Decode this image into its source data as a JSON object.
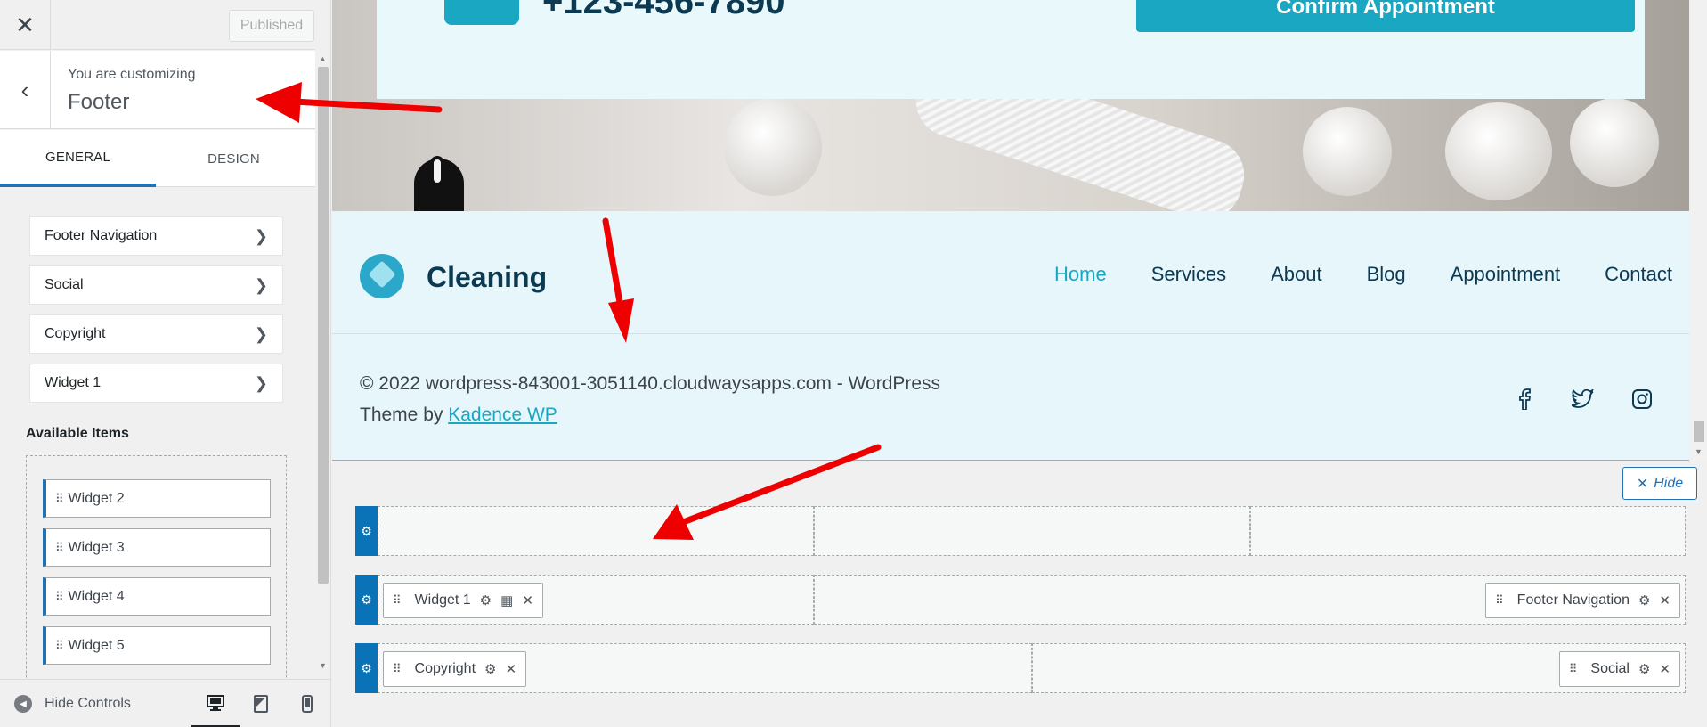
{
  "colors": {
    "accent": "#2271b1",
    "brand": "#19a7c2",
    "brand_dark": "#0c3a52",
    "arrow": "#ee0000"
  },
  "topbar": {
    "close_icon": "close-icon",
    "published_label": "Published"
  },
  "customizing": {
    "label": "You are customizing",
    "title": "Footer"
  },
  "tabs": [
    {
      "label": "GENERAL",
      "active": true
    },
    {
      "label": "DESIGN",
      "active": false
    }
  ],
  "sections": [
    {
      "label": "Footer Navigation"
    },
    {
      "label": "Social"
    },
    {
      "label": "Copyright"
    },
    {
      "label": "Widget 1"
    }
  ],
  "available": {
    "title": "Available Items",
    "items": [
      {
        "label": "Widget 2"
      },
      {
        "label": "Widget 3"
      },
      {
        "label": "Widget 4"
      },
      {
        "label": "Widget 5"
      }
    ]
  },
  "controls": {
    "hide_label": "Hide Controls",
    "devices": [
      "desktop-icon",
      "tablet-icon",
      "mobile-icon"
    ]
  },
  "site": {
    "phone": "+123-456-7890",
    "confirm_label": "Confirm Appointment",
    "logo_text": "Cleaning",
    "nav": [
      {
        "label": "Home",
        "current": true
      },
      {
        "label": "Services",
        "current": false
      },
      {
        "label": "About",
        "current": false
      },
      {
        "label": "Blog",
        "current": false
      },
      {
        "label": "Appointment",
        "current": false
      },
      {
        "label": "Contact",
        "current": false
      }
    ],
    "copyright_line1": "© 2022 wordpress-843001-3051140.cloudwaysapps.com - WordPress",
    "copyright_prefix": "Theme by ",
    "copyright_link": "Kadence WP",
    "socials": [
      "facebook-icon",
      "twitter-icon",
      "instagram-icon"
    ]
  },
  "builder": {
    "hide_label": "Hide",
    "row2": {
      "left_item": "Widget 1",
      "right_item": "Footer Navigation"
    },
    "row3": {
      "left_item": "Copyright",
      "right_item": "Social"
    }
  }
}
